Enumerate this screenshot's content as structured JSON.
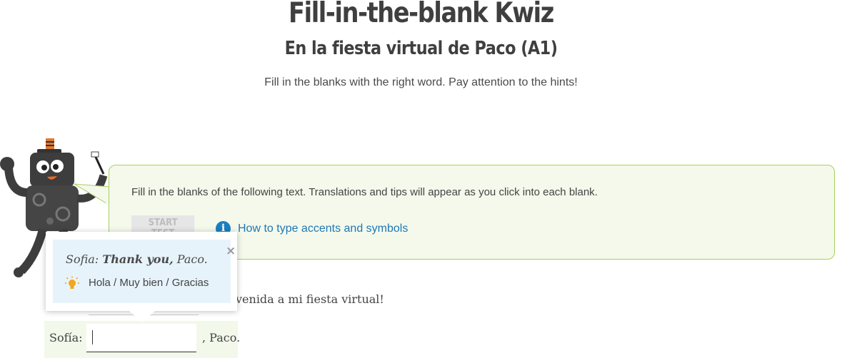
{
  "header": {
    "title": "Fill-in-the-blank Kwiz",
    "subtitle": "En la fiesta virtual de Paco (A1)",
    "intro": "Fill in the blanks with the right word. Pay attention to the hints!"
  },
  "instructions": {
    "text": "Fill in the blanks of the following text. Translations and tips will appear as you click into each blank.",
    "start_button": "START TEST",
    "accents_link": "How to type accents and symbols",
    "info_glyph": "i"
  },
  "exercise": {
    "line1_visible": "venida a mi fiesta virtual!",
    "line2": {
      "speaker": "Sofía:",
      "value": "",
      "after": ", Paco."
    }
  },
  "tooltip": {
    "close": "×",
    "speaker": "Sofia:",
    "translation": "Thank you,",
    "translation_rest": "Paco.",
    "hint": "Hola / Muy bien / Gracias"
  },
  "colors": {
    "accent_green": "#a9d05b",
    "panel_bg": "#f4f9ec",
    "link_blue": "#1f77b4",
    "tooltip_bg": "#e6f3fb",
    "bulb": "#f4a51c"
  },
  "icons": {
    "info": "info-icon",
    "close": "close-icon",
    "hint": "lightbulb-icon",
    "mascot": "robot-mascot"
  }
}
